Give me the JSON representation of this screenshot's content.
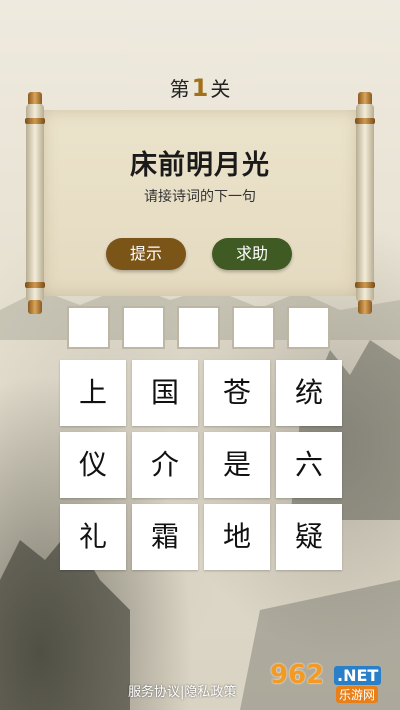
{
  "level": {
    "prefix": "第",
    "number": "1",
    "suffix": "关"
  },
  "question": {
    "line": "床前明月光",
    "prompt": "请接诗词的下一句"
  },
  "buttons": {
    "hint": "提示",
    "help": "求助"
  },
  "answer_slots": [
    "",
    "",
    "",
    "",
    ""
  ],
  "tiles": [
    "上",
    "国",
    "苍",
    "统",
    "仪",
    "介",
    "是",
    "六",
    "礼",
    "霜",
    "地",
    "疑"
  ],
  "footer": {
    "text": "服务协议|隐私政策"
  },
  "watermark": {
    "number": "962",
    "net": ".NET",
    "sub": "乐游网"
  },
  "colors": {
    "hint_button": "#7b5518",
    "help_button": "#3f5a23",
    "level_number": "#a0701a"
  }
}
